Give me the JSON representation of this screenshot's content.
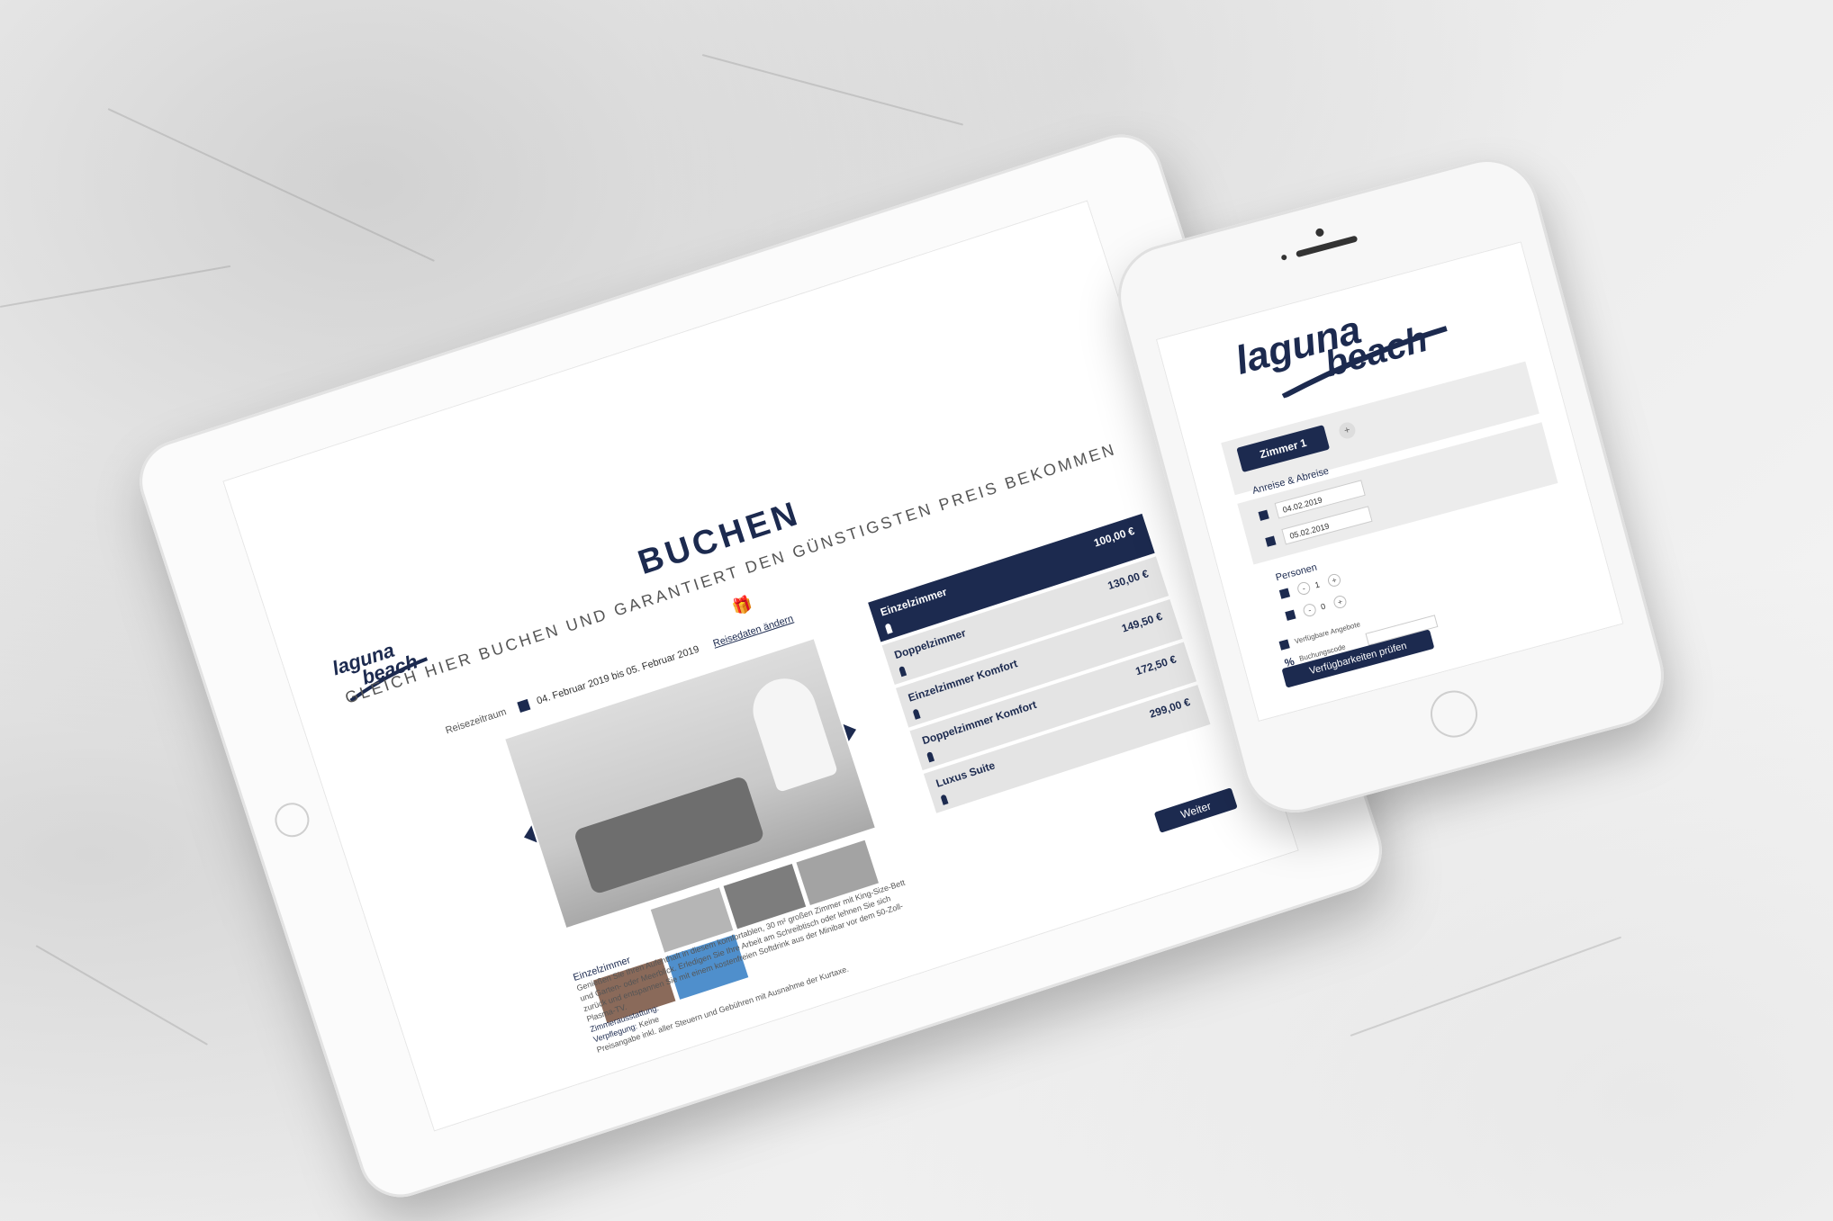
{
  "tablet": {
    "title": "BUCHEN",
    "subtitle": "GLEICH HIER BUCHEN UND GARANTIERT DEN GÜNSTIGSTEN PREIS BEKOMMEN",
    "period_label": "Reisezeitraum",
    "period_value": "04. Februar 2019 bis 05. Februar 2019",
    "change_link": "Reisedaten ändern",
    "rooms": [
      {
        "name": "Einzelzimmer",
        "price": "100,00 €"
      },
      {
        "name": "Doppelzimmer",
        "price": "130,00 €"
      },
      {
        "name": "Einzelzimmer Komfort",
        "price": "149,50 €"
      },
      {
        "name": "Doppelzimmer Komfort",
        "price": "172,50 €"
      },
      {
        "name": "Luxus Suite",
        "price": "299,00 €"
      }
    ],
    "room_detail": {
      "name": "Einzelzimmer",
      "description": "Genießen Sie Ihren Aufenthalt in diesem komfortablen, 30 m² großen Zimmer mit King-Size-Bett und Garten- oder Meerblick. Erledigen Sie Ihre Arbeit am Schreibtisch oder lehnen Sie sich zurück und entspannen Sie mit einem kostenfreien Softdrink aus der Minibar vor dem 50-Zoll-Plasma-TV.",
      "equipment_label": "Zimmerausstattung:",
      "meals_label": "Verpflegung:",
      "meals_value": "Keine",
      "tax_note": "Preisangabe inkl. aller Steuern und Gebühren mit Ausnahme der Kurtaxe."
    },
    "next_button": "Weiter"
  },
  "phone": {
    "tab_label": "Zimmer 1",
    "plus": "+",
    "dates_label": "Anreise & Abreise",
    "arrival": "04.02.2019",
    "departure": "05.02.2019",
    "persons_label": "Personen",
    "adults": "1",
    "children": "0",
    "offers_label": "Verfügbare Angebote",
    "code_label": "Buchungscode",
    "check_button": "Verfügbarkeiten prüfen"
  },
  "colors": {
    "brand": "#1c2a4f",
    "inactive": "#e4e4e4"
  }
}
